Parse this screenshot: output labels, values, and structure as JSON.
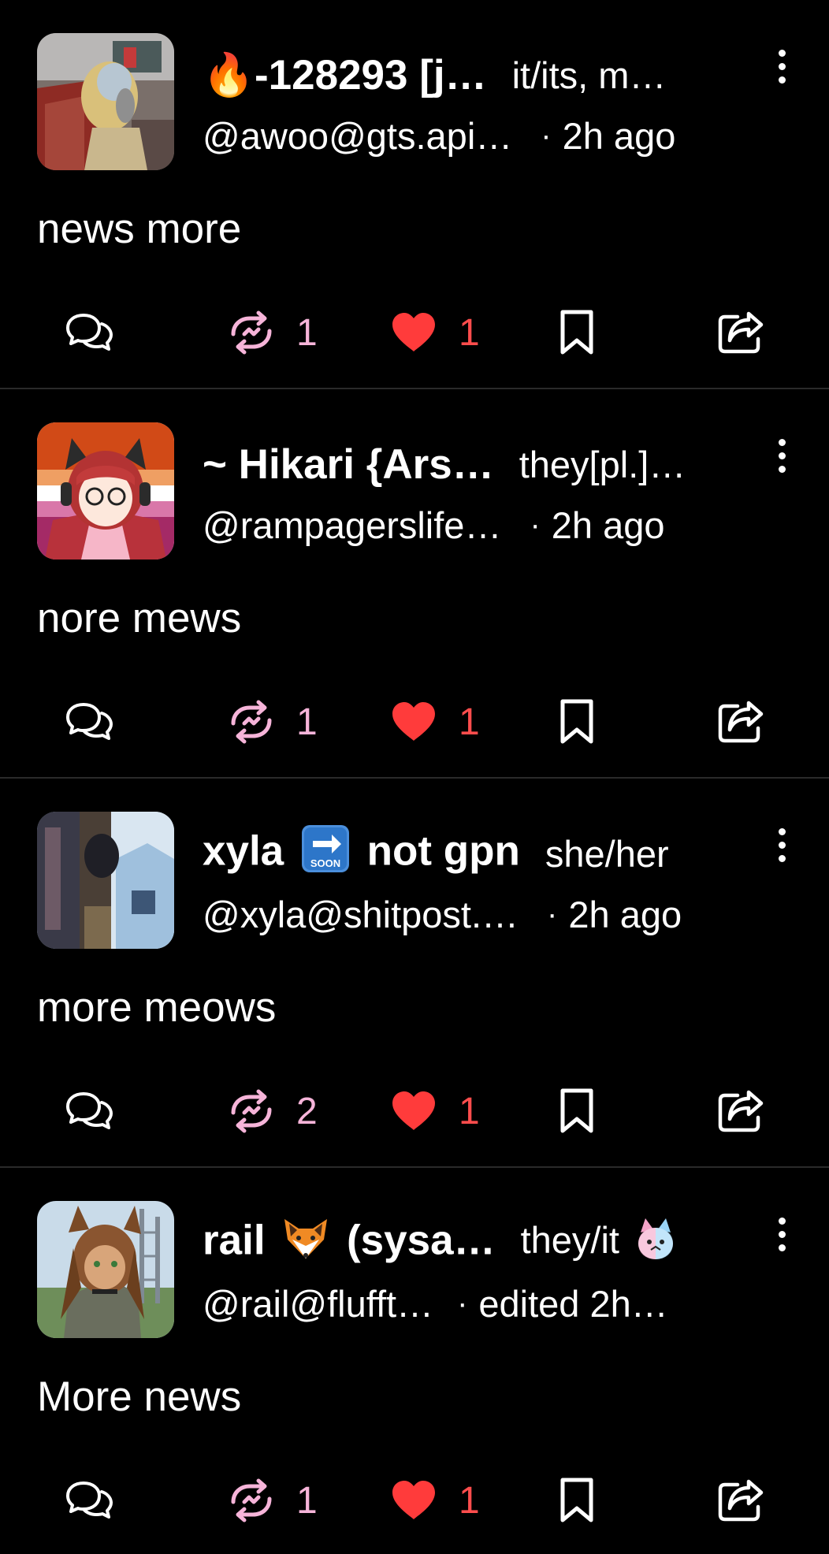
{
  "theme": {
    "background": "#000000",
    "text": "#ffffff",
    "boost_color": "#f6b4d9",
    "favourite_color": "#ff3b3b",
    "divider": "#2a2a2a"
  },
  "posts": [
    {
      "display_name": "🔥-128293 [j…",
      "pronouns": "it/its, m…",
      "handle": "@awoo@gts.api…",
      "time": "2h ago",
      "content": "news more",
      "boosts": "1",
      "favourites": "1"
    },
    {
      "display_name": "~ Hikari {Ars…",
      "pronouns": "they[pl.]…",
      "handle": "@rampagerslife…",
      "time": "2h ago",
      "content": "nore mews",
      "boosts": "1",
      "favourites": "1"
    },
    {
      "display_name_before": "xyla",
      "display_name_after": "not gpn",
      "soon_badge": "SOON",
      "pronouns": "she/her",
      "handle": "@xyla@shitpost.…",
      "time": "2h ago",
      "content": "more meows",
      "boosts": "2",
      "favourites": "1"
    },
    {
      "display_name_before": "rail",
      "display_name_after": "(sysa…",
      "pronouns": "they/it",
      "handle": "@rail@flufft…",
      "time": "edited 2h…",
      "content": "More news",
      "boosts": "1",
      "favourites": "1"
    }
  ],
  "icons": {
    "reply": "speech-bubbles-icon",
    "boost": "repeat-icon",
    "favourite": "heart-icon",
    "bookmark": "bookmark-icon",
    "share": "share-icon",
    "more": "vertical-ellipsis-icon",
    "separator": "·"
  }
}
